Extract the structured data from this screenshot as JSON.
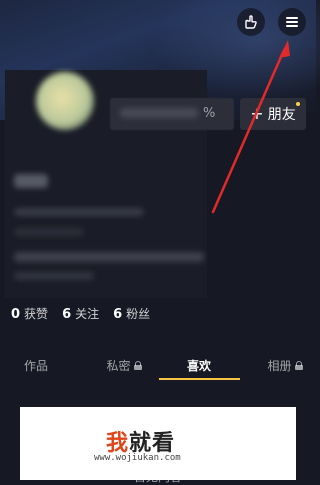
{
  "friend_button": {
    "label": "朋友",
    "plus": "+"
  },
  "edit_profile": {
    "percent_text": "%"
  },
  "stats": [
    {
      "value": "0",
      "label": "获赞"
    },
    {
      "value": "6",
      "label": "关注"
    },
    {
      "value": "6",
      "label": "粉丝"
    }
  ],
  "tabs": [
    {
      "label": "作品",
      "locked": false
    },
    {
      "label": "私密",
      "locked": true
    },
    {
      "label": "喜欢",
      "locked": false,
      "active": true
    },
    {
      "label": "相册",
      "locked": true
    }
  ],
  "empty_state": "首无内容",
  "watermark": {
    "title_first": "我",
    "title_rest": "就看",
    "url": "www.wojiukan.com"
  },
  "colors": {
    "accent_yellow": "#f6c443",
    "annotation_red": "#e32a2a",
    "background": "#161823"
  },
  "icons": {
    "hand": "hand-pointer-icon",
    "menu": "hamburger-menu-icon"
  }
}
